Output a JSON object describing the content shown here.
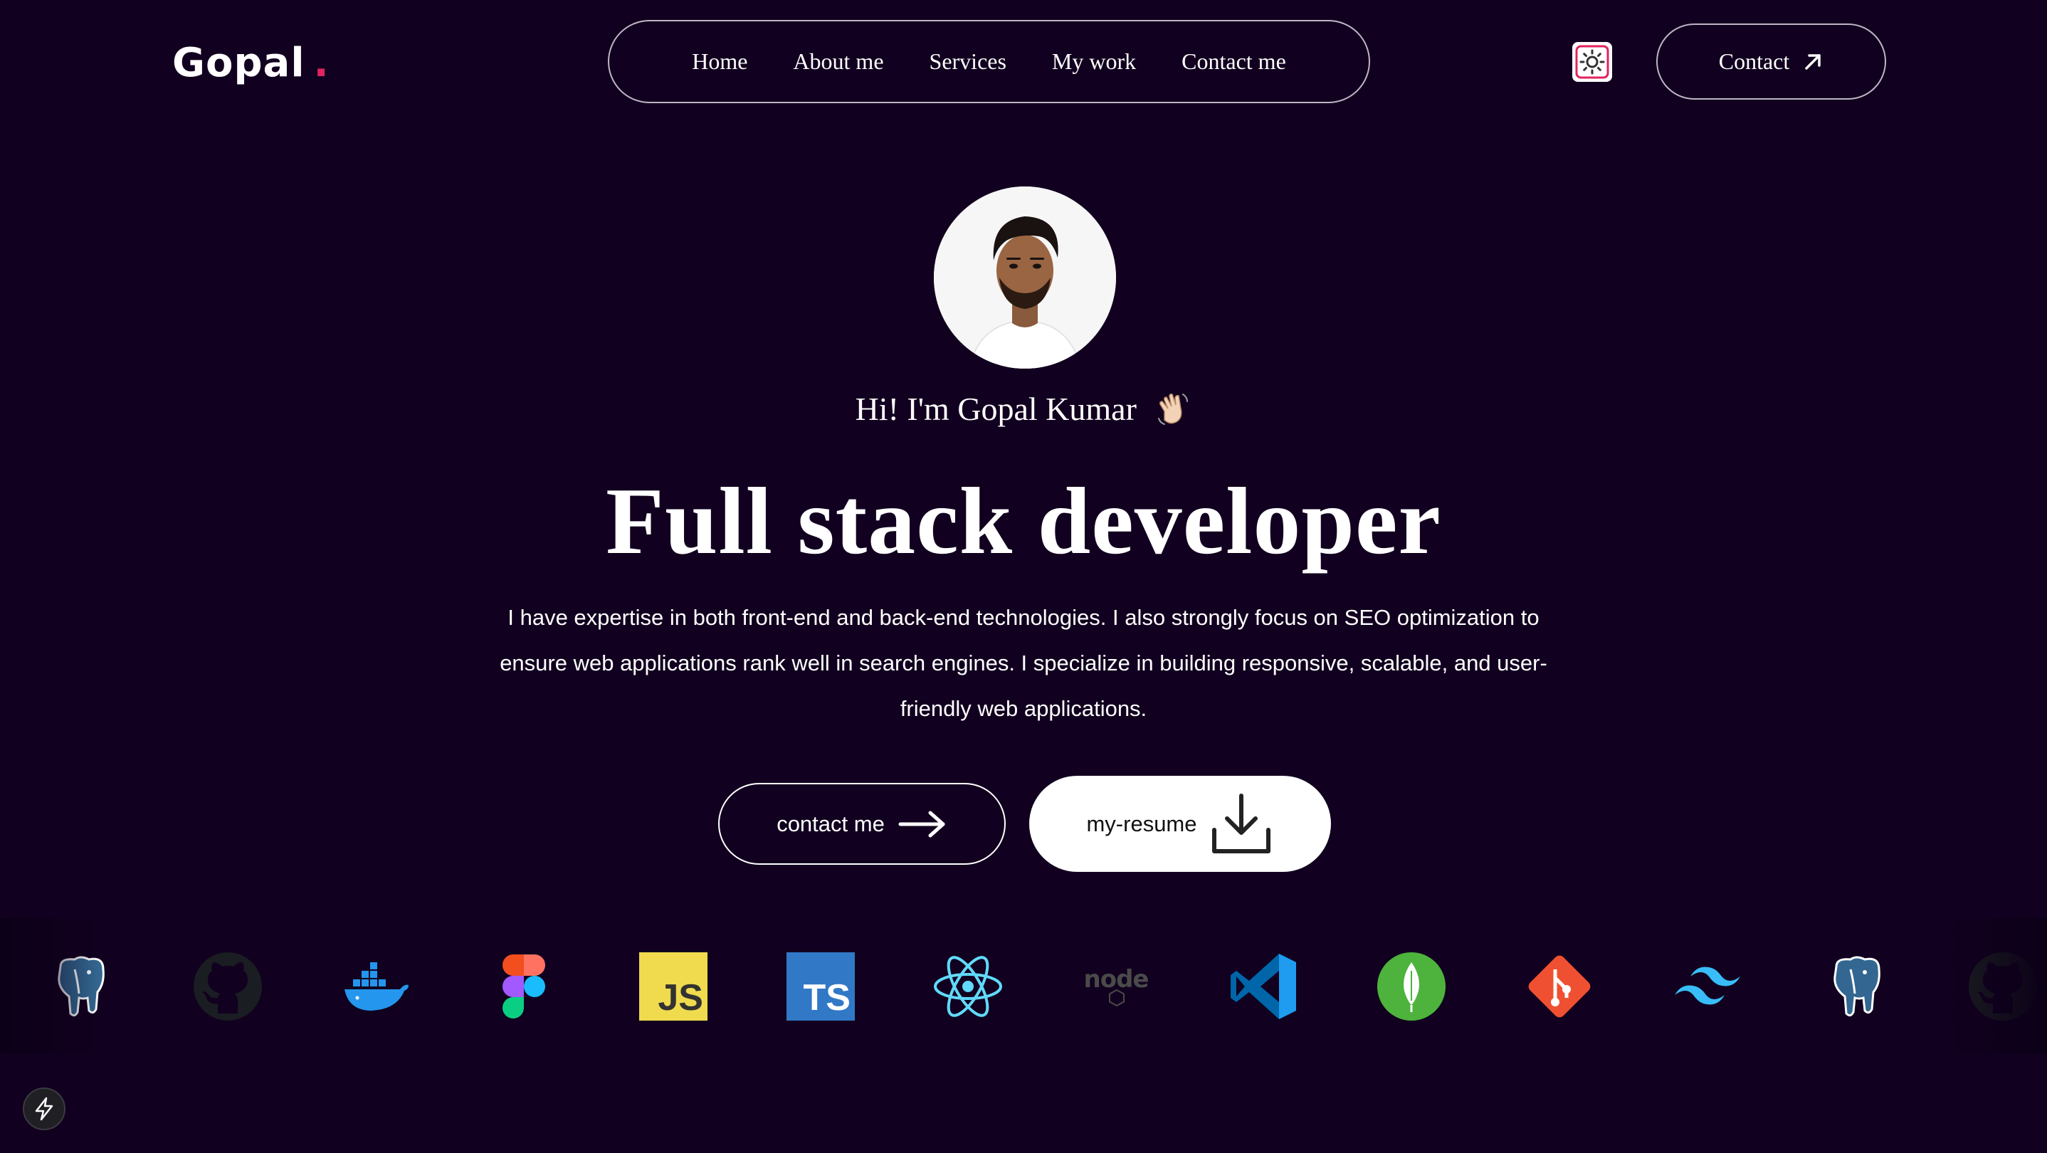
{
  "header": {
    "logo": "Gopal",
    "logo_dot": ".",
    "nav": [
      "Home",
      "About me",
      "Services",
      "My work",
      "Contact me"
    ],
    "contact_label": "Contact"
  },
  "hero": {
    "greeting": "Hi! I'm Gopal Kumar",
    "headline": "Full stack developer",
    "description": "I have expertise in both front-end and back-end technologies. I also strongly focus on SEO optimization to ensure web applications rank well in search engines. I specialize in building responsive, scalable, and user-friendly web applications.",
    "contact_button": "contact me",
    "resume_button": "my-resume"
  },
  "tech_stack": {
    "icons": [
      "postgresql-icon",
      "github-icon",
      "docker-icon",
      "figma-icon",
      "javascript-icon",
      "typescript-icon",
      "react-icon",
      "nodejs-icon",
      "vscode-icon",
      "mongodb-icon",
      "git-icon",
      "tailwind-icon",
      "postgresql-icon",
      "github-icon"
    ],
    "js_label": "JS",
    "ts_label": "TS",
    "node_label": "node"
  },
  "colors": {
    "background": "#11001f",
    "accent_dot": "#e0245e",
    "text": "#ffffff"
  }
}
